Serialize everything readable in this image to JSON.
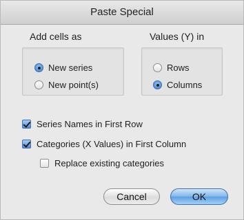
{
  "dialog": {
    "title": "Paste Special"
  },
  "add_cells_as": {
    "label": "Add cells as",
    "options": [
      {
        "label": "New series",
        "selected": true
      },
      {
        "label": "New point(s)",
        "selected": false
      }
    ]
  },
  "values_y_in": {
    "label": "Values (Y) in",
    "options": [
      {
        "label": "Rows",
        "selected": false
      },
      {
        "label": "Columns",
        "selected": true
      }
    ]
  },
  "checkboxes": [
    {
      "label": "Series Names in First Row",
      "checked": true
    },
    {
      "label": "Categories (X Values) in First Column",
      "checked": true
    },
    {
      "label": "Replace existing categories",
      "checked": false
    }
  ],
  "buttons": {
    "cancel_label": "Cancel",
    "ok_label": "OK"
  },
  "colors": {
    "accent": "#5d9fe3",
    "dialog_bg": "#e9e9e9"
  }
}
